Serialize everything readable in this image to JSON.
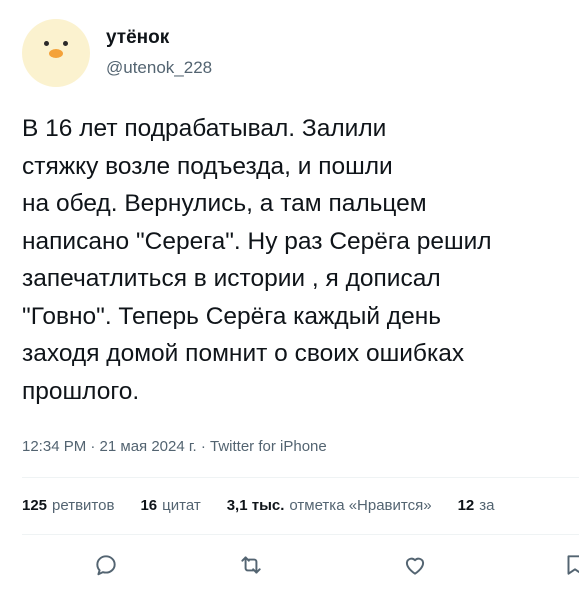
{
  "author": {
    "display_name": "утёнок",
    "handle": "@utenok_228",
    "avatar_icon": "duck-avatar-icon"
  },
  "tweet": {
    "text": "В 16 лет подрабатывал. Залили\nстяжку возле подъезда, и пошли\nна обед. Вернулись, а там пальцем\nнаписано \"Серега\". Ну раз Серёга решил\nзапечатлиться в истории , я дописал\n\"Говно\". Теперь Серёга каждый день\nзаходя домой помнит о своих ошибках\nпрошлого.",
    "meta": "12:34 PM · 21 мая 2024 г. · Twitter for iPhone"
  },
  "stats": [
    {
      "count": "125",
      "label": "ретвитов"
    },
    {
      "count": "16",
      "label": "цитат"
    },
    {
      "count": "3,1 тыс.",
      "label": "отметка «Нравится»"
    },
    {
      "count": "12",
      "label": "за"
    }
  ],
  "actions": {
    "reply_icon": "reply-icon",
    "retweet_icon": "retweet-icon",
    "like_icon": "heart-icon",
    "share_icon": "share-icon"
  },
  "colors": {
    "secondary_text": "#536471",
    "primary_text": "#0f1419",
    "divider": "#eff3f4"
  }
}
